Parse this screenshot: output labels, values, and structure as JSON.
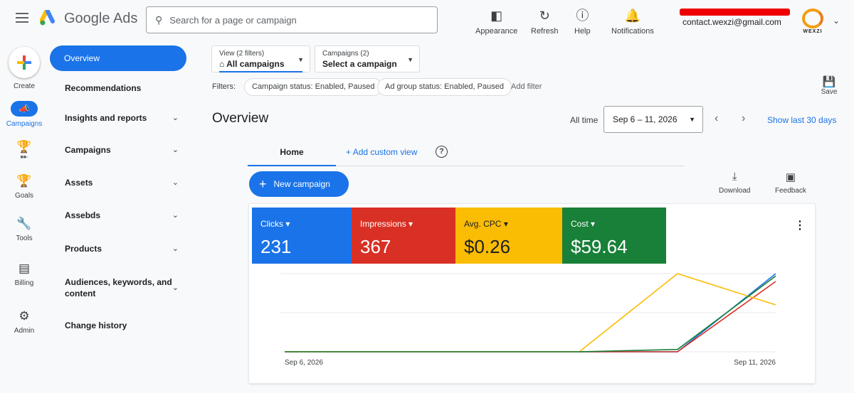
{
  "header": {
    "app_name": "Google Ads",
    "search_placeholder": "Search for a page or campaign",
    "buttons": [
      {
        "label": "Appearance",
        "icon": "appearance-icon"
      },
      {
        "label": "Refresh",
        "icon": "refresh-icon"
      },
      {
        "label": "Help",
        "icon": "help-icon"
      },
      {
        "label": "Notifications",
        "icon": "bell-icon"
      }
    ],
    "account_email": "contact.wexzi@gmail.com",
    "account_logo_text": "WEXZI"
  },
  "rail": {
    "create": "Create",
    "campaigns": "Campaigns",
    "goals": "Goals",
    "tools": "Tools",
    "billing": "Billing",
    "admin": "Admin"
  },
  "nav": {
    "overview": "Overview",
    "recommendations": "Recommendations",
    "insights": "Insights and reports",
    "campaigns": "Campaigns",
    "assets": "Assets",
    "assets2": "Assebds",
    "products": "Products",
    "audiences_1": "Audiences, keywords, and",
    "audiences_2": "content",
    "change_history": "Change history"
  },
  "main": {
    "view_small": "View (2 filters)",
    "view_big": "All campaigns",
    "camp_small": "Campaigns (2)",
    "camp_big": "Select a campaign",
    "filters_label": "Filters:",
    "chip_1": "Campaign status: Enabled, Paused",
    "chip_2": "Ad group status: Enabled, Paused",
    "add_filter": "Add filter",
    "save": "Save",
    "title": "Overview",
    "all_time": "All time",
    "date_range": "Sep 6 – 11, 2026",
    "show_last": "Show last 30 days",
    "tab_home": "Home",
    "tab_add": "Add custom view",
    "new_campaign": "New campaign",
    "download": "Download",
    "feedback": "Feedback"
  },
  "metrics": [
    {
      "label": "Clicks",
      "value": "231",
      "color": "#1a73e8"
    },
    {
      "label": "Impressions",
      "value": "367",
      "color": "#d93025"
    },
    {
      "label": "Avg. CPC",
      "value": "$0.26",
      "color": "#fbbc04"
    },
    {
      "label": "Cost",
      "value": "$59.64",
      "color": "#188038"
    }
  ],
  "chart_data": {
    "type": "line",
    "x": [
      "Sep 6, 2026",
      "Sep 7, 2026",
      "Sep 8, 2026",
      "Sep 9, 2026",
      "Sep 10, 2026",
      "Sep 11, 2026"
    ],
    "x_tick_labels": [
      "Sep 6, 2026",
      "Sep 11, 2026"
    ],
    "ylim": [
      0,
      1
    ],
    "grid": true,
    "series": [
      {
        "color": "#1a73e8",
        "values": [
          0,
          0,
          0,
          0,
          0,
          1.0
        ]
      },
      {
        "color": "#d93025",
        "values": [
          0,
          0,
          0,
          0,
          0,
          0.9
        ]
      },
      {
        "color": "#fbbc04",
        "values": [
          0,
          0,
          0,
          0,
          1.0,
          0.6
        ]
      },
      {
        "color": "#188038",
        "values": [
          0,
          0,
          0,
          0,
          0.03,
          0.97
        ]
      }
    ]
  }
}
